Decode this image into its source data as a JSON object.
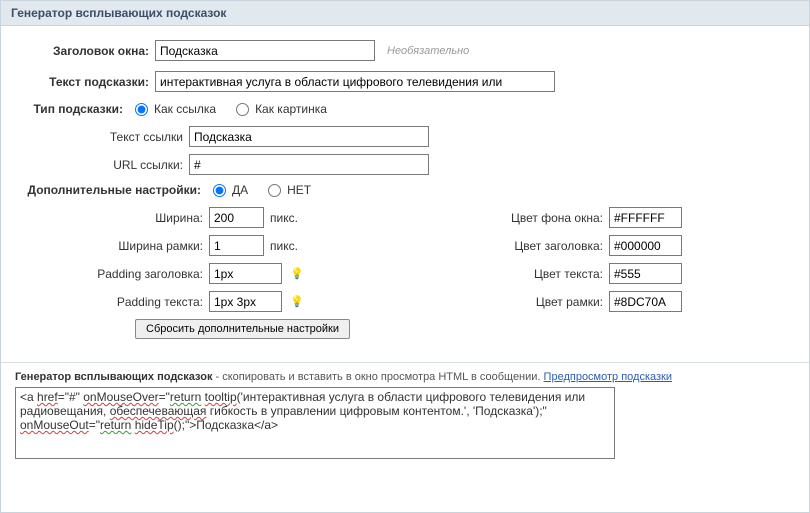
{
  "header": "Генератор всплывающих подсказок",
  "window_title_label": "Заголовок окна:",
  "window_title_value": "Подсказка",
  "optional_hint": "Необязательно",
  "tooltip_text_label": "Текст подсказки:",
  "tooltip_text_value": "интерактивная услуга в области цифрового телевидения или",
  "tip_type_label": "Тип подсказки:",
  "tip_type_options": {
    "link": "Как ссылка",
    "image": "Как картинка"
  },
  "link_text_label": "Текст ссылки",
  "link_text_value": "Подсказка",
  "link_url_label": "URL ссылки:",
  "link_url_value": "#",
  "extra_settings_label": "Дополнительные настройки:",
  "extra_yes": "ДА",
  "extra_no": "НЕТ",
  "width_label": "Ширина:",
  "width_value": "200",
  "border_width_label": "Ширина рамки:",
  "border_width_value": "1",
  "padding_header_label": "Padding заголовка:",
  "padding_header_value": "1px",
  "padding_text_label": "Padding текста:",
  "padding_text_value": "1px 3px",
  "units_px": "пикс.",
  "bg_color_label": "Цвет фона окна:",
  "bg_color_value": "#FFFFFF",
  "header_color_label": "Цвет заголовка:",
  "header_color_value": "#000000",
  "text_color_label": "Цвет текста:",
  "text_color_value": "#555",
  "border_color_label": "Цвет рамки:",
  "border_color_value": "#8DC70A",
  "reset_button": "Сбросить дополнительные настройки",
  "output_title": "Генератор всплывающих подсказок",
  "output_desc": " - скопировать и вставить в окно просмотра HTML в сообщении. ",
  "preview_link": "Предпросмотр подсказки",
  "code": {
    "p1": "<a ",
    "p2": "href",
    "p3": "=\"#\" ",
    "p4": "onMouseOver",
    "p5": "=\"",
    "p6": "return",
    "p7": " ",
    "p8": "tooltip",
    "p9": "('интерактивная услуга в области цифрового телевидения или радиовещания, ",
    "p10": "обеспечевающая",
    "p11": " гибкость в управлении цифровым контентом.', 'Подсказка');\" ",
    "p12": "onMouseOut",
    "p13": "=\"",
    "p14": "return",
    "p15": " ",
    "p16": "hideTip",
    "p17": "();\">Подсказка</a>"
  }
}
